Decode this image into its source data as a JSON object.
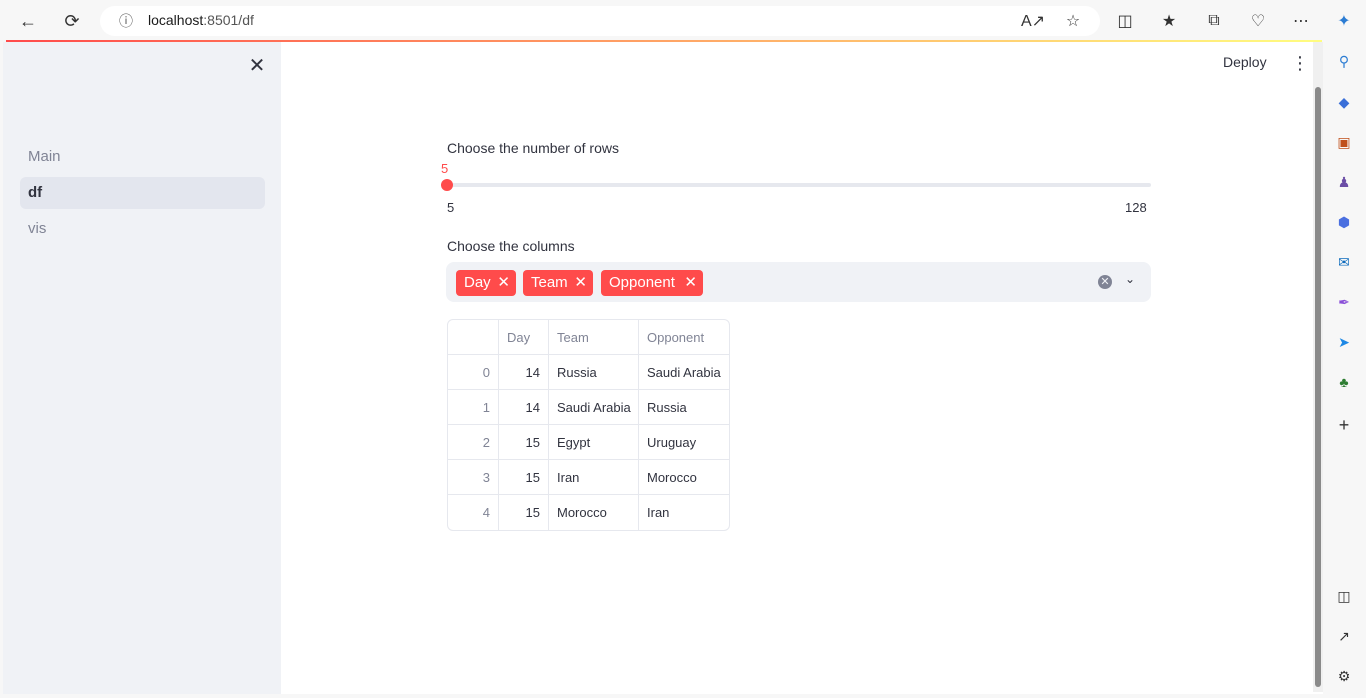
{
  "browser": {
    "url": "localhost:8501/df",
    "url_host": "localhost",
    "url_rest": ":8501/df"
  },
  "sidebar": {
    "items": [
      {
        "label": "Main",
        "active": false
      },
      {
        "label": "df",
        "active": true
      },
      {
        "label": "vis",
        "active": false
      }
    ]
  },
  "header": {
    "deploy_label": "Deploy"
  },
  "slider": {
    "label": "Choose the number of rows",
    "value": "5",
    "min": "5",
    "max": "128",
    "fraction": 0
  },
  "multiselect": {
    "label": "Choose the columns",
    "chips": [
      "Day",
      "Team",
      "Opponent"
    ]
  },
  "table": {
    "columns": [
      "",
      "Day",
      "Team",
      "Opponent"
    ],
    "rows": [
      [
        "0",
        "14",
        "Russia",
        "Saudi Arabia"
      ],
      [
        "1",
        "14",
        "Saudi Arabia",
        "Russia"
      ],
      [
        "2",
        "15",
        "Egypt",
        "Uruguay"
      ],
      [
        "3",
        "15",
        "Iran",
        "Morocco"
      ],
      [
        "4",
        "15",
        "Morocco",
        "Iran"
      ]
    ]
  },
  "colors": {
    "accent": "#ff4b4b",
    "sidebar_bg": "#f0f2f6"
  }
}
